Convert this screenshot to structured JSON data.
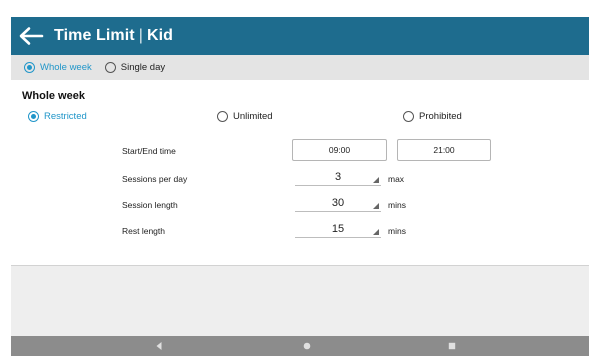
{
  "header": {
    "title": "Time Limit",
    "separator": "|",
    "profile": "Kid",
    "background_color": "#1e6c8e",
    "back_icon": "arrow-left-icon"
  },
  "mode": {
    "options": [
      {
        "label": "Whole week",
        "selected": true
      },
      {
        "label": "Single day",
        "selected": false
      }
    ]
  },
  "section": {
    "title": "Whole week"
  },
  "limit_type": {
    "options": [
      {
        "label": "Restricted",
        "selected": true
      },
      {
        "label": "Unlimited",
        "selected": false
      },
      {
        "label": "Prohibited",
        "selected": false
      }
    ]
  },
  "settings": {
    "start_end": {
      "label": "Start/End time",
      "start": "09:00",
      "separator": "-",
      "end": "21:00"
    },
    "sessions_per_day": {
      "label": "Sessions per day",
      "value": "3",
      "unit": "max"
    },
    "session_length": {
      "label": "Session length",
      "value": "30",
      "unit": "mins"
    },
    "rest_length": {
      "label": "Rest length",
      "value": "15",
      "unit": "mins"
    }
  },
  "colors": {
    "accent": "#2196c9",
    "nav_bar": "#8c8c8c"
  },
  "navigation": {
    "back": "nav-back-icon",
    "home": "nav-home-icon",
    "recents": "nav-recents-icon"
  }
}
